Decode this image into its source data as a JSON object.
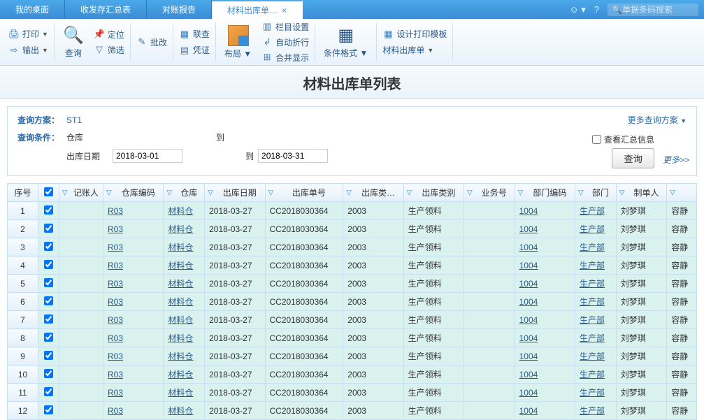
{
  "tabs": [
    {
      "label": "我的桌面"
    },
    {
      "label": "收发存汇总表"
    },
    {
      "label": "对账报告"
    },
    {
      "label": "材料出库单…",
      "active": true,
      "closable": true
    }
  ],
  "search": {
    "placeholder": "单据条码搜索"
  },
  "ribbon": {
    "print": "打印",
    "output": "输出",
    "search": "查询",
    "locate": "定位",
    "filter": "筛选",
    "batch": "批改",
    "link": "联查",
    "voucher": "凭证",
    "layout": "布局",
    "col_set": "栏目设置",
    "auto_wrap": "自动折行",
    "merge_disp": "合并显示",
    "cond_fmt": "条件格式",
    "design_tpl": "设计打印模板",
    "out_list": "材料出库单"
  },
  "page_title": "材料出库单列表",
  "query": {
    "scheme_label": "查询方案：",
    "scheme_value": "ST1",
    "cond_label": "查询条件：",
    "warehouse_label": "仓库",
    "to_label": "到",
    "date_label": "出库日期",
    "date_from": "2018-03-01",
    "date_to_label": "到",
    "date_to": "2018-03-31",
    "more_schemes": "更多查询方案",
    "view_summary": "查看汇总信息",
    "btn_query": "查询",
    "more": "更多>>"
  },
  "columns": {
    "seq": "序号",
    "poster": "记账人",
    "wh_code": "仓库编码",
    "wh": "仓库",
    "out_date": "出库日期",
    "out_no": "出库单号",
    "out_kind": "出库类…",
    "out_type": "出库类别",
    "biz_no": "业务号",
    "dept_code": "部门编码",
    "dept": "部门",
    "maker": "制单人"
  },
  "row_data": {
    "wh_code": "R03",
    "wh": "材料仓",
    "out_date": "2018-03-27",
    "out_no": "CC2018030364",
    "out_kind": "2003",
    "out_type": "生产领料",
    "dept_code": "1004",
    "dept": "生产部",
    "maker": "刘梦琪",
    "last": "容静"
  },
  "row_count": 12
}
